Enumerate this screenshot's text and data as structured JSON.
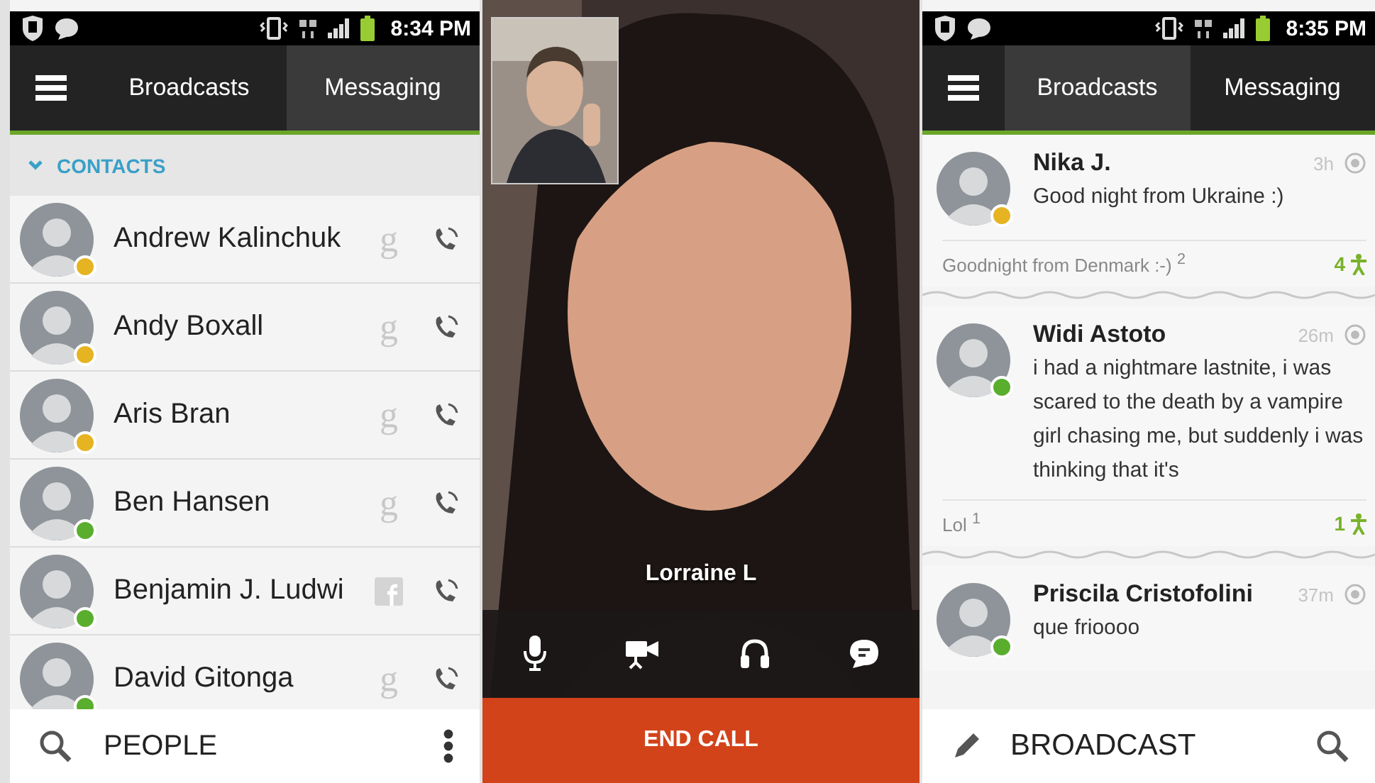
{
  "contacts_screen": {
    "status_bar": {
      "time": "8:34 PM"
    },
    "tabs": [
      {
        "label": "Broadcasts",
        "selected": false
      },
      {
        "label": "Messaging",
        "selected": true
      }
    ],
    "section_header": "CONTACTS",
    "contacts": [
      {
        "name": "Andrew Kalinchuk",
        "color": "#e6b422",
        "network": {
          "kind": "letter",
          "text": "g"
        }
      },
      {
        "name": "Andy Boxall",
        "color": "#e6b422",
        "network": {
          "kind": "letter",
          "text": "g"
        }
      },
      {
        "name": "Aris Bran",
        "color": "#e6b422",
        "network": {
          "kind": "letter",
          "text": "g"
        }
      },
      {
        "name": "Ben Hansen",
        "color": "#5aae2e",
        "network": {
          "kind": "letter",
          "text": "g"
        }
      },
      {
        "name": "Benjamin J. Ludwi",
        "color": "#5aae2e",
        "network": {
          "kind": "logo"
        }
      },
      {
        "name": "David Gitonga",
        "color": "#5aae2e",
        "network": {
          "kind": "letter",
          "text": "g"
        }
      }
    ],
    "bottom_bar": {
      "label": "PEOPLE"
    }
  },
  "call_screen": {
    "caller": "Lorraine L",
    "end_button": "END CALL"
  },
  "broadcasts_screen": {
    "status_bar": {
      "time": "8:35 PM"
    },
    "tabs": [
      {
        "label": "Broadcasts",
        "selected": true
      },
      {
        "label": "Messaging",
        "selected": false
      }
    ],
    "posts": [
      {
        "name": "Nika J.",
        "time": "3h",
        "color": "#e6b422",
        "text": "Good night from Ukraine :)",
        "reply": "Goodnight from Denmark :-) $^{2}$",
        "count": "4"
      },
      {
        "name": "Widi Astoto",
        "time": "26m",
        "color": "#5aae2e",
        "text": "i had a nightmare lastnite, i was scared to the death by a vampire girl chasing me, but suddenly i was thinking that it's",
        "reply": "Lol $^{1}$",
        "count": "1"
      },
      {
        "name": "Priscila Cristofolini",
        "time": "37m",
        "color": "#5aae2e",
        "text": "que frioooo"
      }
    ],
    "bottom_bar": {
      "label": "BROADCAST"
    }
  }
}
